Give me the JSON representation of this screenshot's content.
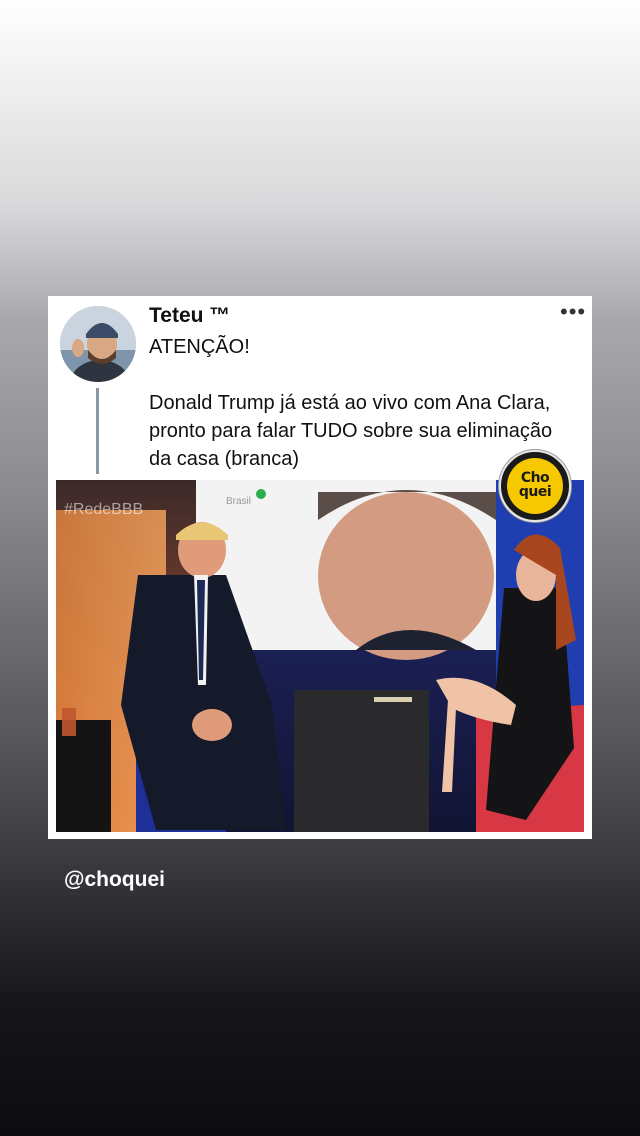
{
  "tweet": {
    "author": "Teteu ™",
    "more_icon": "more-horizontal-icon",
    "text": "ATENÇÃO!\n\nDonald Trump já está ao vivo com Ana Clara, pronto  para falar TUDO sobre sua eliminação da casa (branca)"
  },
  "media": {
    "hashtag_logo": "#RedeBBB",
    "channel_logo": "Brasil"
  },
  "badge": {
    "text": "Cho\nquei"
  },
  "story": {
    "mention": "@choquei"
  }
}
